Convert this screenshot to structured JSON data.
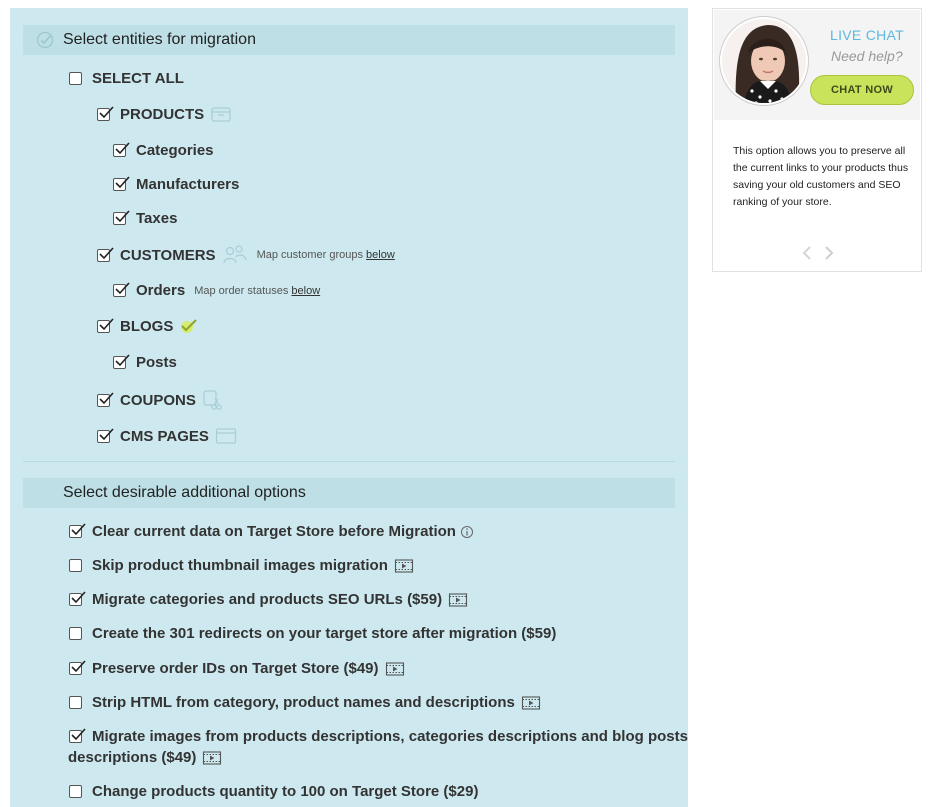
{
  "entities_section": {
    "title": "Select entities for migration",
    "select_all": "SELECT ALL",
    "items": [
      {
        "label": "PRODUCTS",
        "checked": true,
        "icon": "box-icon"
      },
      {
        "label": "Categories",
        "checked": true
      },
      {
        "label": "Manufacturers",
        "checked": true
      },
      {
        "label": "Taxes",
        "checked": true
      },
      {
        "label": "CUSTOMERS",
        "checked": true,
        "icon": "users-icon",
        "note": "Map customer groups",
        "note_link": "below"
      },
      {
        "label": "Orders",
        "checked": true,
        "note": "Map order statuses",
        "note_link": "below"
      },
      {
        "label": "BLOGS",
        "checked": true,
        "icon": "blog-check-icon"
      },
      {
        "label": "Posts",
        "checked": true
      },
      {
        "label": "COUPONS",
        "checked": true,
        "icon": "coupon-scissors-icon"
      },
      {
        "label": "CMS PAGES",
        "checked": true,
        "icon": "page-window-icon"
      }
    ]
  },
  "options_section": {
    "title": "Select desirable additional options",
    "items": [
      {
        "label": "Clear current data on Target Store before Migration",
        "checked": true,
        "icon": "info-icon"
      },
      {
        "label": "Skip product thumbnail images migration",
        "checked": false,
        "icon": "video-icon"
      },
      {
        "label": "Migrate categories and products SEO URLs ($59)",
        "checked": true,
        "icon": "video-icon"
      },
      {
        "label": "Create the 301 redirects on your target store after migration ($59)",
        "checked": false
      },
      {
        "label": "Preserve order IDs on Target Store ($49)",
        "checked": true,
        "icon": "video-icon"
      },
      {
        "label": "Strip HTML from category, product names and descriptions",
        "checked": false,
        "icon": "video-icon"
      },
      {
        "label": "Migrate images from products descriptions, categories descriptions and blog posts",
        "label_line2": "descriptions ($49)",
        "checked": true,
        "icon": "video-icon"
      },
      {
        "label": "Change products quantity to 100 on Target Store ($29)",
        "checked": false
      }
    ]
  },
  "chat": {
    "title": "LIVE CHAT",
    "subtitle": "Need help?",
    "button": "CHAT NOW",
    "text": "This option allows you to preserve all the current links to your products thus saving your old customers and SEO ranking of your store.",
    "accent": "#5bb8df",
    "button_color": "#c9e35a"
  },
  "colors": {
    "panel_bg": "#cde9ef",
    "header_bg": "#bddfe5"
  }
}
